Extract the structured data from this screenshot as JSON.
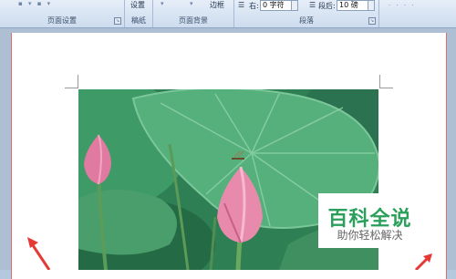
{
  "ribbon": {
    "groups": [
      {
        "name": "page-setup",
        "title": "页面设置"
      },
      {
        "name": "draft-paper",
        "title": "稿纸",
        "button": "设置"
      },
      {
        "name": "page-background",
        "title": "页面背景",
        "button": "边框"
      },
      {
        "name": "paragraph",
        "title": "段落"
      }
    ],
    "paragraph": {
      "right_indent_label": "右:",
      "right_indent_value": "0 字符",
      "spacing_after_label": "段后:",
      "spacing_after_value": "10 磅"
    }
  },
  "watermark": {
    "title": "百科全说",
    "subtitle": "助你轻松解决"
  },
  "colors": {
    "arrow": "#e53935",
    "watermark_green": "#2aa05b"
  }
}
